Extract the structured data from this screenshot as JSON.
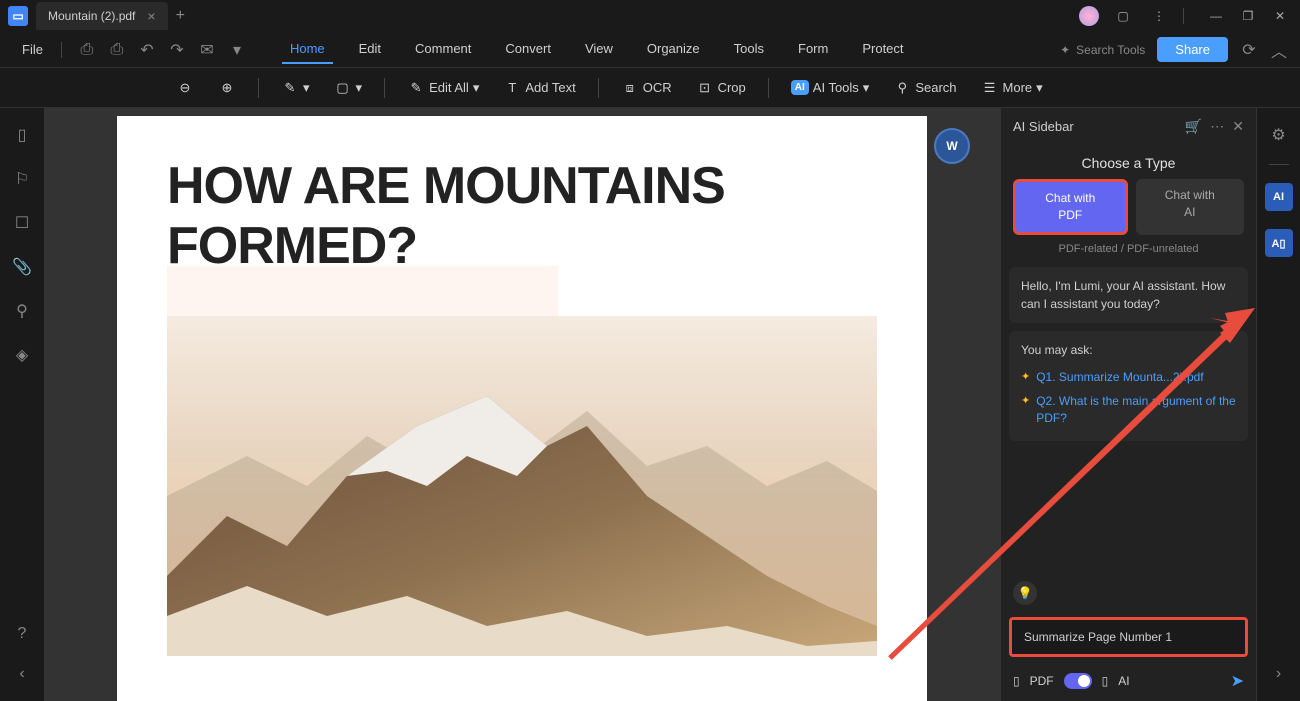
{
  "titlebar": {
    "tab_title": "Mountain (2).pdf"
  },
  "menubar": {
    "file": "File",
    "items": [
      "Home",
      "Edit",
      "Comment",
      "Convert",
      "View",
      "Organize",
      "Tools",
      "Form",
      "Protect"
    ],
    "search_tools": "Search Tools",
    "share": "Share"
  },
  "toolbar": {
    "edit_all": "Edit All",
    "add_text": "Add Text",
    "ocr": "OCR",
    "crop": "Crop",
    "ai_tools": "AI Tools",
    "search": "Search",
    "more": "More"
  },
  "document": {
    "heading": "HOW ARE MOUNTAINS FORMED?"
  },
  "ai_sidebar": {
    "title": "AI Sidebar",
    "choose_type": "Choose a Type",
    "tab_pdf_line1": "Chat with",
    "tab_pdf_line2": "PDF",
    "tab_ai_line1": "Chat with",
    "tab_ai_line2": "AI",
    "subtitle": "PDF-related / PDF-unrelated",
    "greeting": "Hello, I'm Lumi, your AI assistant. How can I assistant you today?",
    "you_may_ask": "You may ask:",
    "q1": "Q1. Summarize Mounta...2).pdf",
    "q2": "Q2. What is the main argument of the PDF?",
    "input_text": "Summarize Page Number 1",
    "footer_pdf": "PDF",
    "footer_ai": "AI"
  }
}
